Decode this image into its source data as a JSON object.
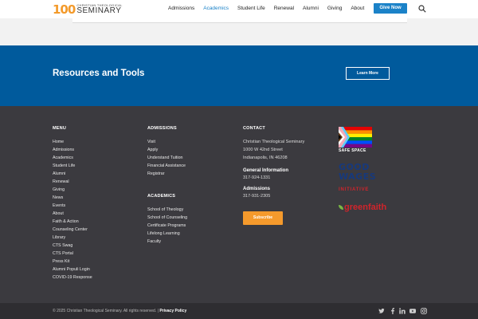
{
  "header": {
    "logo_number": "100",
    "logo_small": "CHRISTIAN THEOLOGICAL",
    "logo_big": "SEMINARY",
    "nav": [
      "Admissions",
      "Academics",
      "Student Life",
      "Renewal",
      "Alumni",
      "Giving",
      "About"
    ],
    "active_nav": "Academics",
    "give_now": "Give Now",
    "search_icon": "search-icon"
  },
  "resources": {
    "title": "Resources and Tools",
    "button": "Learn More"
  },
  "footer": {
    "menu": {
      "heading": "MENU",
      "items": [
        "Home",
        "Admissions",
        "Academics",
        "Student Life",
        "Alumni",
        "Renewal",
        "Giving",
        "News",
        "Events",
        "About",
        "Faith & Action",
        "Counseling Center",
        "Library",
        "CTS Swag",
        "CTS Portal",
        "Press Kit",
        "Alumni Populi Login",
        "COVID-19 Response"
      ]
    },
    "admissions": {
      "heading": "ADMISSIONS",
      "items": [
        "Visit",
        "Apply",
        "Understand Tuition",
        "Financial Assistance",
        "Registrar"
      ]
    },
    "academics": {
      "heading": "ACADEMICS",
      "items": [
        "School of Theology",
        "School of Counseling",
        "Certificate Programs",
        "Lifelong Learning",
        "Faculty"
      ]
    },
    "contact": {
      "heading": "CONTACT",
      "line1": "Christian Theological Seminary",
      "line2": "1000 W 42nd Street",
      "line3": "Indianapolis, IN 46208",
      "general_label": "General Information",
      "general_phone": "317-924-1331",
      "admissions_label": "Admissions",
      "admissions_phone": "317-931-2305",
      "subscribe": "Subscribe"
    },
    "badges": {
      "safe_space": "SAFE SPACE",
      "good": "GOOD",
      "wages": "WAGES",
      "initiative": "INITIATIVE",
      "greenfaith": "greenfaith"
    },
    "bottom": {
      "copyright": "© 2025 Christian Theological Seminary. All rights reserved. |",
      "privacy": "Privacy Policy",
      "social": [
        "twitter-icon",
        "facebook-icon",
        "linkedin-icon",
        "youtube-icon",
        "instagram-icon"
      ]
    }
  },
  "colors": {
    "brand_blue": "#1b82c8",
    "band_blue": "#005a9c",
    "footer_bg": "#3b3a3f",
    "accent_orange": "#f59a2c"
  }
}
